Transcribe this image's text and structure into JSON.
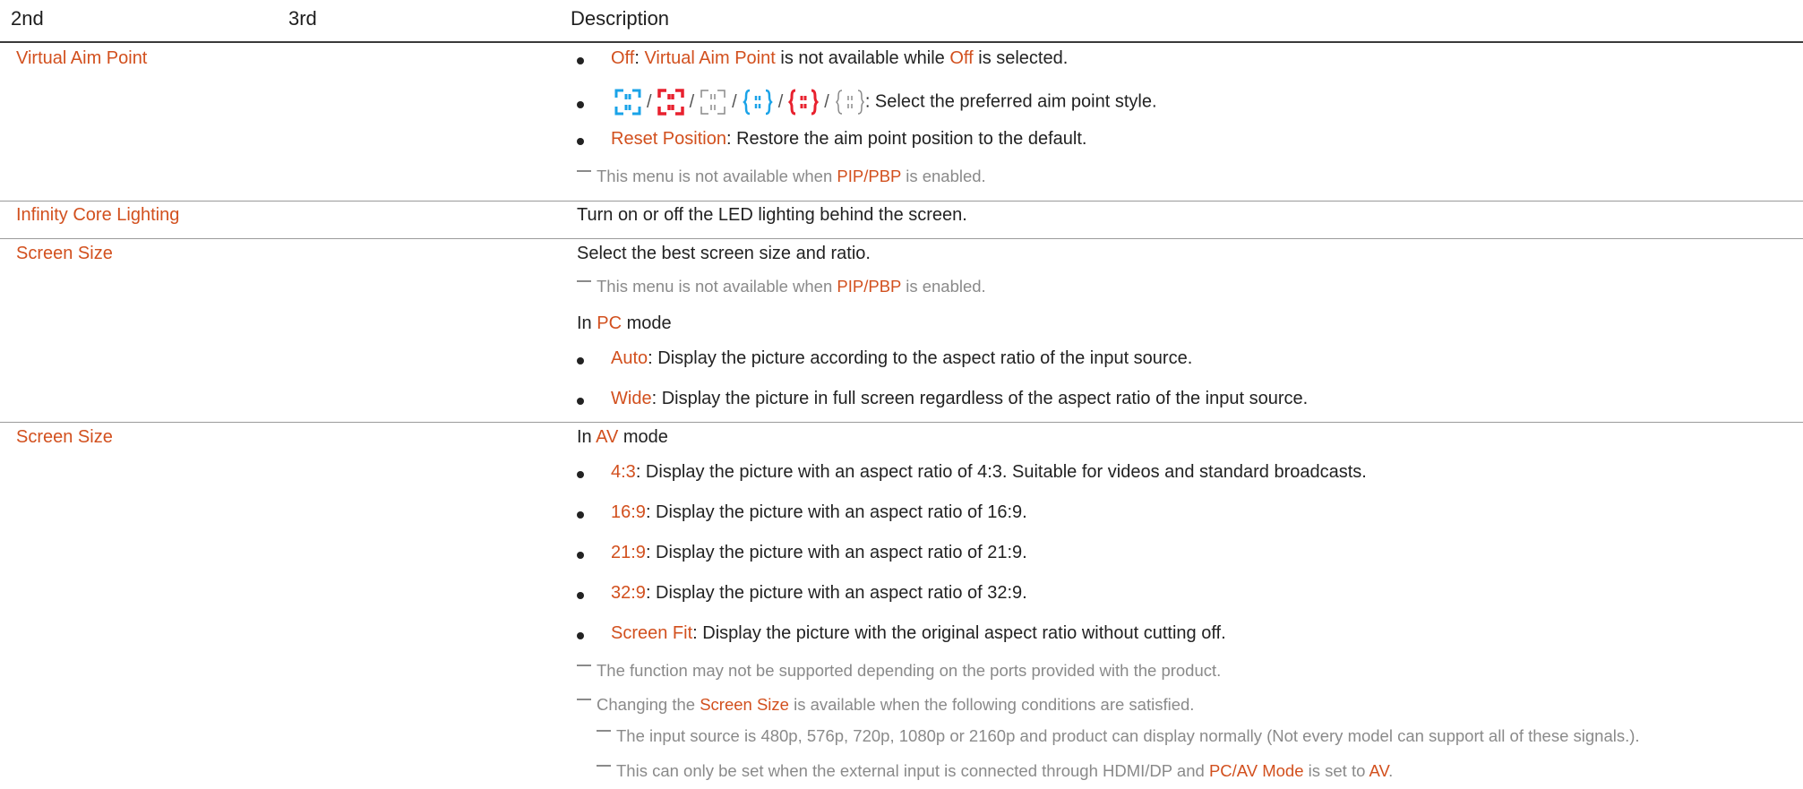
{
  "header": {
    "col2": "2nd",
    "col3": "3rd",
    "col_desc": "Description"
  },
  "rows": [
    {
      "label": "Virtual Aim Point",
      "off": {
        "pre_key": "Off",
        "sep": ": ",
        "key2": "Virtual Aim Point",
        "mid": " is not available while ",
        "key3": "Off",
        "post": " is selected."
      },
      "icons_text": ": Select the preferred aim point style.",
      "icon_names": [
        "aim-point-style-1-icon",
        "aim-point-style-2-icon",
        "aim-point-style-3-icon",
        "aim-point-style-4-icon",
        "aim-point-style-5-icon",
        "aim-point-style-6-icon"
      ],
      "icon_sep": "/",
      "reset": {
        "key": "Reset Position",
        "text": ": Restore the aim point position to the default."
      },
      "note": {
        "pre": "This menu is not available when ",
        "key": "PIP/PBP",
        "post": " is enabled."
      }
    },
    {
      "label": "Infinity Core Lighting",
      "text": "Turn on or off the LED lighting behind the screen."
    },
    {
      "label": "Screen Size",
      "text": "Select the best screen size and ratio.",
      "note": {
        "pre": "This menu is not available when ",
        "key": "PIP/PBP",
        "post": " is enabled."
      },
      "mode": {
        "pre": "In ",
        "key": "PC",
        "post": " mode"
      },
      "items": [
        {
          "key": "Auto",
          "text": ": Display the picture according to the aspect ratio of the input source."
        },
        {
          "key": "Wide",
          "text": ": Display the picture in full screen regardless of the aspect ratio of the input source."
        }
      ]
    },
    {
      "label": "Screen Size",
      "mode": {
        "pre": "In ",
        "key": "AV",
        "post": " mode"
      },
      "items": [
        {
          "key": "4:3",
          "text": ": Display the picture with an aspect ratio of 4:3. Suitable for videos and standard broadcasts."
        },
        {
          "key": "16:9",
          "text": ": Display the picture with an aspect ratio of 16:9."
        },
        {
          "key": "21:9",
          "text": ": Display the picture with an aspect ratio of 21:9."
        },
        {
          "key": "32:9",
          "text": ": Display the picture with an aspect ratio of 32:9."
        },
        {
          "key": "Screen Fit",
          "text": ": Display the picture with the original aspect ratio without cutting off."
        }
      ],
      "note1": "The function may not be supported depending on the ports provided with the product.",
      "note2": {
        "pre": "Changing the ",
        "key": "Screen Size",
        "post": " is available when the following conditions are satisfied."
      },
      "sub1": "The input source is 480p, 576p, 720p, 1080p or 2160p and product can display normally (Not every model can support all of these signals.).",
      "sub2": {
        "pre": "This can only be set when the external input is connected through HDMI/DP and ",
        "key": "PC/AV Mode",
        "mid": " is set to ",
        "key2": "AV",
        "post": "."
      }
    }
  ],
  "colors": {
    "accent": "#d2501e",
    "note": "#8a8a8a",
    "icon_blue": "#1aa3e8",
    "icon_red": "#e8212e",
    "icon_gray": "#8a8a8a"
  }
}
